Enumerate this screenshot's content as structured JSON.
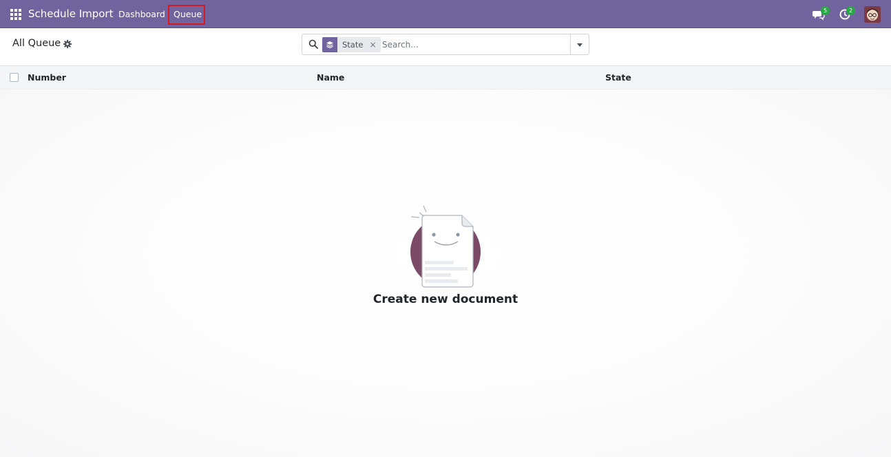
{
  "navbar": {
    "app_title": "Schedule Import",
    "menu": {
      "dashboard": "Dashboard",
      "queue": "Queue"
    },
    "messages_count": "5",
    "activities_count": "2",
    "icons": [
      "apps-grid-icon",
      "chat-icon",
      "clock-icon",
      "user-avatar"
    ],
    "background_color": "#71639e",
    "highlight_color": "#d71920"
  },
  "control_panel": {
    "title": "All Queue",
    "search": {
      "facet_label": "State",
      "facet_remove": "×",
      "placeholder": "Search..."
    }
  },
  "list": {
    "columns": [
      "Number",
      "Name",
      "State"
    ],
    "rows": []
  },
  "empty_state": {
    "title": "Create new document"
  }
}
